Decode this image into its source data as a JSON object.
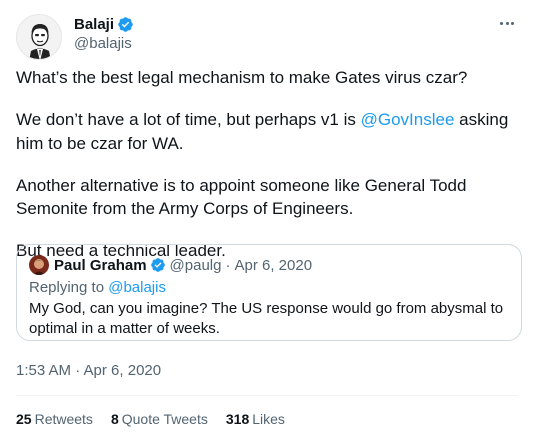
{
  "author": {
    "display_name": "Balaji",
    "handle": "@balajis",
    "verified_color": "#1d9bf0"
  },
  "more_icon": "more-horizontal-icon",
  "tweet": {
    "line1": "What’s the best legal mechanism to make Gates virus czar?",
    "line2_before": "We don’t have a lot of time, but perhaps v1 is ",
    "line2_mention": "@GovInslee",
    "line2_after": " asking him to be czar for WA.",
    "line3": "Another alternative is to appoint someone like General Todd Semonite from the Army Corps of Engineers.",
    "line4": "But need a technical leader."
  },
  "quoted": {
    "display_name": "Paul Graham",
    "handle": "@paulg",
    "separator": "·",
    "date": "Apr 6, 2020",
    "replying_prefix": "Replying to",
    "replying_mention": "@balajis",
    "text": "My God, can you imagine? The US response would go from abysmal to optimal in a matter of weeks."
  },
  "timestamp": "1:53 AM · Apr 6, 2020",
  "stats": {
    "retweets_count": "25",
    "retweets_label": "Retweets",
    "quotes_count": "8",
    "quotes_label": "Quote Tweets",
    "likes_count": "318",
    "likes_label": "Likes"
  },
  "colors": {
    "link": "#1d9bf0",
    "secondary_text": "#536471",
    "border": "#cfd9de"
  }
}
